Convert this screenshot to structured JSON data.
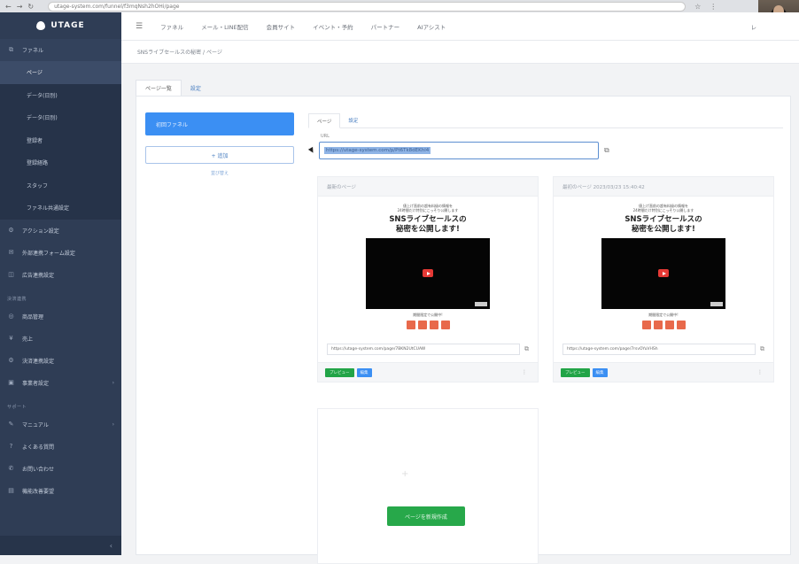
{
  "browser": {
    "nav": [
      "←",
      "→",
      "↻"
    ],
    "url": "utage-system.com/funnel/f3mqNsh2hOHi/page",
    "icons": [
      "☆",
      "⋮"
    ]
  },
  "sidebar": {
    "logo": "UTAGE",
    "items": [
      {
        "label": "ファネル",
        "icon": "funnel-icon",
        "glyph": "⧉"
      },
      {
        "label": "アクション設定",
        "icon": "action-icon",
        "glyph": "⚙"
      },
      {
        "label": "外部連携フォーム設定",
        "icon": "form-icon",
        "glyph": "✉"
      },
      {
        "label": "広告連携設定",
        "icon": "ad-icon",
        "glyph": "◫"
      }
    ],
    "sub_items": [
      "ページ",
      "データ(日別)",
      "データ(日別)",
      "登録者",
      "登録経路",
      "スタッフ",
      "ファネル共通設定"
    ],
    "section1": "決済連携",
    "items2": [
      {
        "label": "商品管理",
        "icon": "product-icon",
        "glyph": "◎"
      },
      {
        "label": "売上",
        "icon": "sales-icon",
        "glyph": "¥"
      },
      {
        "label": "決済連携設定",
        "icon": "payment-icon",
        "glyph": "⚙"
      },
      {
        "label": "事業者設定",
        "icon": "business-icon",
        "glyph": "▣"
      }
    ],
    "section2": "サポート",
    "items3": [
      {
        "label": "マニュアル",
        "icon": "manual-icon",
        "glyph": "✎"
      },
      {
        "label": "よくある質問",
        "icon": "faq-icon",
        "glyph": "?"
      },
      {
        "label": "お問い合わせ",
        "icon": "contact-icon",
        "glyph": "✆"
      },
      {
        "label": "機能改善要望",
        "icon": "request-icon",
        "glyph": "▤"
      }
    ],
    "collapse": "‹"
  },
  "topbar": {
    "menu_icon": "☰",
    "links": [
      "ファネル",
      "メール・LINE配信",
      "会員サイト",
      "イベント・予約",
      "パートナー",
      "AIアシスト"
    ],
    "user": "レ"
  },
  "breadcrumb": "SNSライブセールスの秘密 / ページ",
  "tabs": [
    "ページ一覧",
    "設定"
  ],
  "left": {
    "funnel_button": "初回ファネル",
    "add_button": "+ 追加",
    "sub_link": "並び替え"
  },
  "right": {
    "inner_tabs": [
      "ページ",
      "設定"
    ],
    "url_label": "URL",
    "url_value": "https://utage-system.com/p/Pt6Tk8dEKhl4",
    "copy_icon": "⧉"
  },
  "cards": [
    {
      "header": "最新のページ",
      "small_text": [
        "値上げ直前の超有料級の情報を",
        "24時間だけ特別にこっそり公開します"
      ],
      "title": [
        "SNSライブセールスの",
        "秘密を公開します!"
      ],
      "note": "期間限定で公開中!",
      "url": "https://utage-system.com/page/7BKN2UtCUAW",
      "preview_btn": "プレビュー",
      "edit_btn": "編集",
      "menu": "⋮"
    },
    {
      "header": "最初のページ 2023/03/23 15:40:42",
      "small_text": [
        "値上げ直前の超有料級の情報を",
        "24時間だけ特別にこっそり公開します"
      ],
      "title": [
        "SNSライブセールスの",
        "秘密を公開します!"
      ],
      "note": "期間限定で公開中!",
      "url": "https://utage-system.com/page/7rsvOYuVHSh",
      "preview_btn": "プレビュー",
      "edit_btn": "編集",
      "menu": "⋮"
    }
  ],
  "create_button": "ページを新規作成",
  "empty_plus": "+",
  "colors": {
    "sidebar": "#2f3d55",
    "primary": "#3b8ff3",
    "success": "#27a84a"
  }
}
